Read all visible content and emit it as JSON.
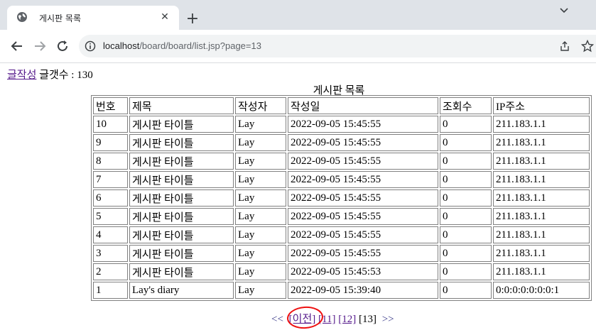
{
  "browser": {
    "tab_title": "게시판 목록",
    "url_host": "localhost",
    "url_path": "/board/board/list.jsp?page=13"
  },
  "page": {
    "write_link": "글작성",
    "count_text": "글갯수 : 130",
    "caption": "게시판 목록",
    "headers": [
      "번호",
      "제목",
      "작성자",
      "작성일",
      "조회수",
      "IP주소"
    ],
    "rows": [
      [
        "10",
        "게시판 타이틀",
        "Lay",
        "2022-09-05 15:45:55",
        "0",
        "211.183.1.1"
      ],
      [
        "9",
        "게시판 타이틀",
        "Lay",
        "2022-09-05 15:45:55",
        "0",
        "211.183.1.1"
      ],
      [
        "8",
        "게시판 타이틀",
        "Lay",
        "2022-09-05 15:45:55",
        "0",
        "211.183.1.1"
      ],
      [
        "7",
        "게시판 타이틀",
        "Lay",
        "2022-09-05 15:45:55",
        "0",
        "211.183.1.1"
      ],
      [
        "6",
        "게시판 타이틀",
        "Lay",
        "2022-09-05 15:45:55",
        "0",
        "211.183.1.1"
      ],
      [
        "5",
        "게시판 타이틀",
        "Lay",
        "2022-09-05 15:45:55",
        "0",
        "211.183.1.1"
      ],
      [
        "4",
        "게시판 타이틀",
        "Lay",
        "2022-09-05 15:45:55",
        "0",
        "211.183.1.1"
      ],
      [
        "3",
        "게시판 타이틀",
        "Lay",
        "2022-09-05 15:45:55",
        "0",
        "211.183.1.1"
      ],
      [
        "2",
        "게시판 타이틀",
        "Lay",
        "2022-09-05 15:45:53",
        "0",
        "211.183.1.1"
      ],
      [
        "1",
        "Lay's diary",
        "Lay",
        "2022-09-05 15:39:40",
        "0",
        "0:0:0:0:0:0:0:1"
      ]
    ],
    "pager": {
      "first": "<<",
      "prev": "[이전]",
      "pages": [
        "[11]",
        "[12]"
      ],
      "current": "[13]",
      "last": ">>"
    }
  },
  "icons": {
    "tab_favicon": "globe-icon",
    "tab_close": "close-icon",
    "new_tab": "plus-icon",
    "tab_search": "chevron-down-icon",
    "back": "back-arrow-icon",
    "forward": "forward-arrow-icon",
    "reload": "reload-icon",
    "site_info": "info-icon",
    "share": "share-icon",
    "bookmark": "star-icon"
  },
  "colors": {
    "visited_link": "#551a8b",
    "annotation_circle": "#e11111"
  }
}
